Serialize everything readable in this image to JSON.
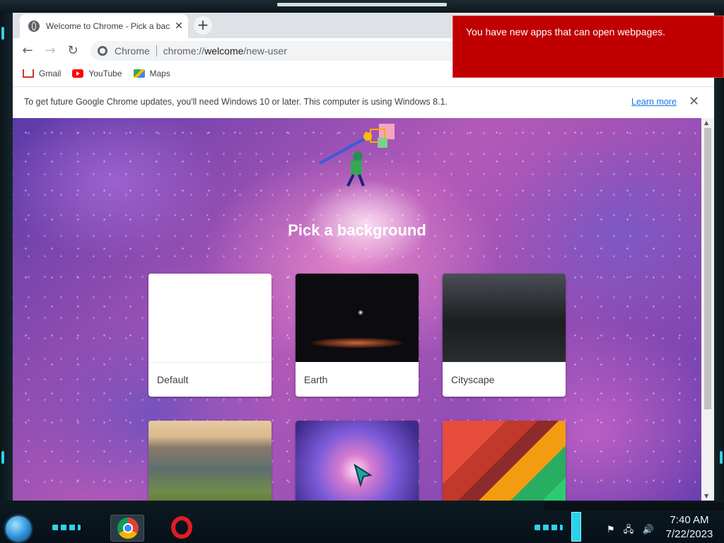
{
  "browser": {
    "tab": {
      "title": "Welcome to Chrome - Pick a background",
      "close": "✕"
    },
    "new_tab": "+",
    "nav": {
      "back": "←",
      "forward": "→",
      "reload": "↻"
    },
    "omnibox": {
      "site_label": "Chrome",
      "url_prefix": "chrome://",
      "url_host": "welcome",
      "url_path": "/new-user"
    },
    "bookmarks": [
      {
        "label": "Gmail",
        "icon": "gmail-icon"
      },
      {
        "label": "YouTube",
        "icon": "youtube-icon"
      },
      {
        "label": "Maps",
        "icon": "maps-icon"
      }
    ],
    "infobar": {
      "message": "To get future Google Chrome updates, you'll need Windows 10 or later. This computer is using Windows 8.1.",
      "link": "Learn more",
      "close": "✕"
    }
  },
  "page": {
    "heading": "Pick a background",
    "backgrounds": [
      {
        "label": "Default"
      },
      {
        "label": "Earth"
      },
      {
        "label": "Cityscape"
      },
      {
        "label": ""
      },
      {
        "label": ""
      },
      {
        "label": ""
      }
    ]
  },
  "notification": {
    "text": "You have new apps that can open webpages."
  },
  "taskbar": {
    "apps": [
      "chrome-icon",
      "opera-icon"
    ],
    "clock": {
      "time": "7:40 AM",
      "date": "7/22/2023"
    },
    "tray_icons": [
      "flag-icon",
      "network-icon",
      "speaker-icon"
    ]
  },
  "colors": {
    "notification_bg": "#c00000",
    "link": "#1a73e8",
    "accent": "#2bd3e8"
  }
}
